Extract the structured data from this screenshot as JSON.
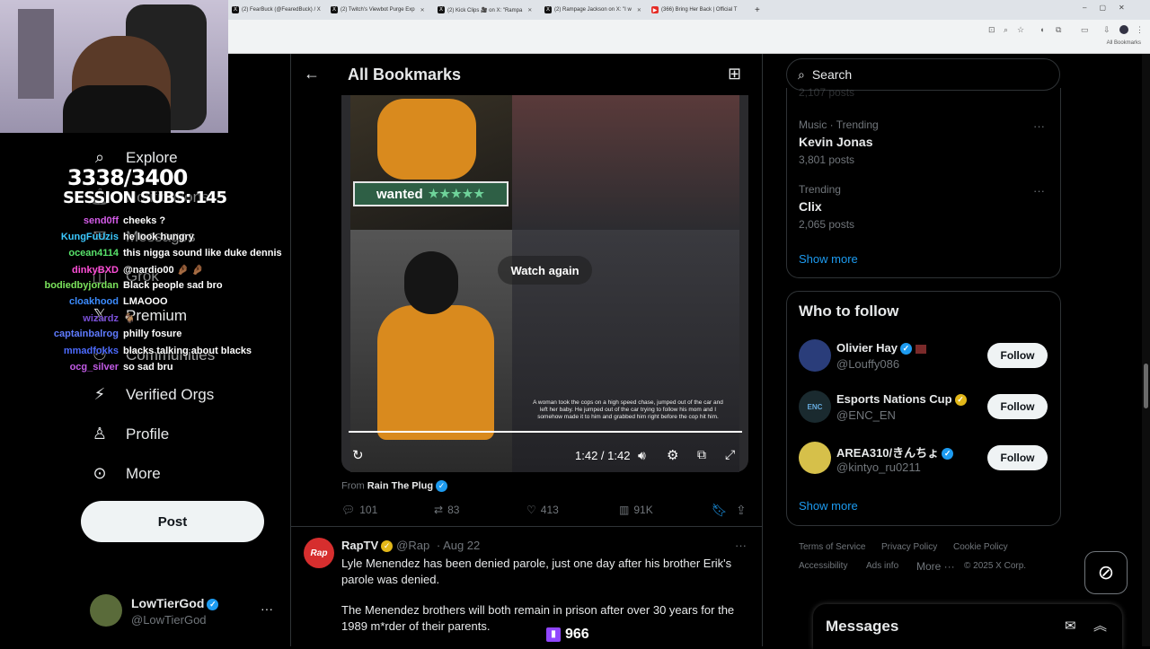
{
  "browser": {
    "tabs": [
      {
        "label": "(2) FearBuck (@FearedBuck) / X",
        "icon": "x-logo"
      },
      {
        "label": "(2) Twitch's Viewbot Purge Exp",
        "icon": "x-logo"
      },
      {
        "label": "(2) Kick Clips 🎥 on X: \"Rampa",
        "icon": "x-logo"
      },
      {
        "label": "(2) Rampage Jackson on X: \"I w",
        "icon": "x-logo"
      },
      {
        "label": "(366) Bring Her Back | Official T",
        "icon": "youtube-logo"
      }
    ],
    "new_tab": "+",
    "bookmarks_label": "All Bookmarks"
  },
  "stream_overlay": {
    "sub_count": "3338/3400",
    "session_subs": "SESSION SUBS: 145",
    "viewer_count": "966",
    "chat": [
      {
        "user": "send0ff",
        "color": "#d45ce8",
        "msg": "cheeks ?"
      },
      {
        "user": "KungFuUzis",
        "color": "#3cc9ff",
        "msg": "he look hungry"
      },
      {
        "user": "ocean4114",
        "color": "#58e36b",
        "msg": "this nigga sound like duke dennis"
      },
      {
        "user": "dinkyBXD",
        "color": "#ff4fd8",
        "msg": "@nardio00 🤌🏾 🤌🏾"
      },
      {
        "user": "bodiedbyjordan",
        "color": "#7be35c",
        "msg": "Black people sad bro"
      },
      {
        "user": "cloakhood",
        "color": "#3c8cff",
        "msg": "LMAOOO"
      },
      {
        "user": "wizardz",
        "color": "#7a4fd8",
        "msg": "🐐"
      },
      {
        "user": "captainbalrog",
        "color": "#5f7bff",
        "msg": "philly fosure"
      },
      {
        "user": "mmadfokks",
        "color": "#4d6bff",
        "msg": "blacks talking about blacks"
      },
      {
        "user": "ocg_silver",
        "color": "#c25be6",
        "msg": "so sad bru"
      }
    ]
  },
  "sidebar": {
    "items": [
      {
        "label": "Explore",
        "icon": "search-icon"
      },
      {
        "label": "Notifications",
        "icon": "bell-icon"
      },
      {
        "label": "Messages",
        "icon": "mail-icon"
      },
      {
        "label": "Grok",
        "icon": "grok-icon"
      },
      {
        "label": "Premium",
        "icon": "x-logo-icon"
      },
      {
        "label": "Communities",
        "icon": "people-icon"
      },
      {
        "label": "Verified Orgs",
        "icon": "lightning-icon"
      },
      {
        "label": "Profile",
        "icon": "person-icon"
      },
      {
        "label": "More",
        "icon": "more-circle-icon"
      }
    ],
    "post_label": "Post",
    "account": {
      "name": "LowTierGod",
      "handle": "@LowTierGod",
      "more": "···"
    }
  },
  "main": {
    "title": "All Bookmarks",
    "video": {
      "wanted_label": "wanted",
      "wanted_stars": "★★★★★",
      "watch_again": "Watch again",
      "time": "1:42 / 1:42",
      "progress": 1.0,
      "caption": "A woman took the cops on a high speed chase, jumped out of the car and left her baby. He jumped out of the car trying to follow his mom and I somehow made it to him and grabbed him right before the cop hit him."
    },
    "from_prefix": "From",
    "from_name": "Rain The Plug",
    "actions": {
      "replies": "101",
      "reposts": "83",
      "likes": "413",
      "views": "91K"
    },
    "tweet2": {
      "name": "RapTV",
      "handle": "@Rap",
      "date": "· Aug 22",
      "avatar_text": "Rap",
      "line1": "Lyle Menendez has been denied parole, just one day after his brother Erik's parole was denied.",
      "line2": "The Menendez brothers will both remain in prison after over 30 years for the 1989 m*rder of their parents."
    }
  },
  "right": {
    "search_placeholder": "Search",
    "trends_top_partial": "2,107 posts",
    "trends": [
      {
        "category": "Music · Trending",
        "name": "Kevin Jonas",
        "count": "3,801 posts"
      },
      {
        "category": "Trending",
        "name": "Clix",
        "count": "2,065 posts"
      }
    ],
    "show_more": "Show more",
    "who_to_follow": {
      "title": "Who to follow",
      "accounts": [
        {
          "name": "Olivier Hay",
          "handle": "@Louffy086",
          "badge": "blue",
          "avatar_color": "#2a3d7a"
        },
        {
          "name": "Esports Nations Cup",
          "handle": "@ENC_EN",
          "badge": "gold",
          "avatar_color": "#1a2a2f"
        },
        {
          "name": "AREA310/きんちょ",
          "handle": "@kintyo_ru0211",
          "badge": "blue",
          "avatar_color": "#d6c04a"
        }
      ],
      "follow_label": "Follow",
      "show_more": "Show more"
    },
    "footer": {
      "terms": "Terms of Service",
      "privacy": "Privacy Policy",
      "cookie": "Cookie Policy",
      "accessibility": "Accessibility",
      "ads": "Ads info",
      "more": "More ···",
      "copyright": "© 2025 X Corp."
    },
    "messages_title": "Messages"
  }
}
